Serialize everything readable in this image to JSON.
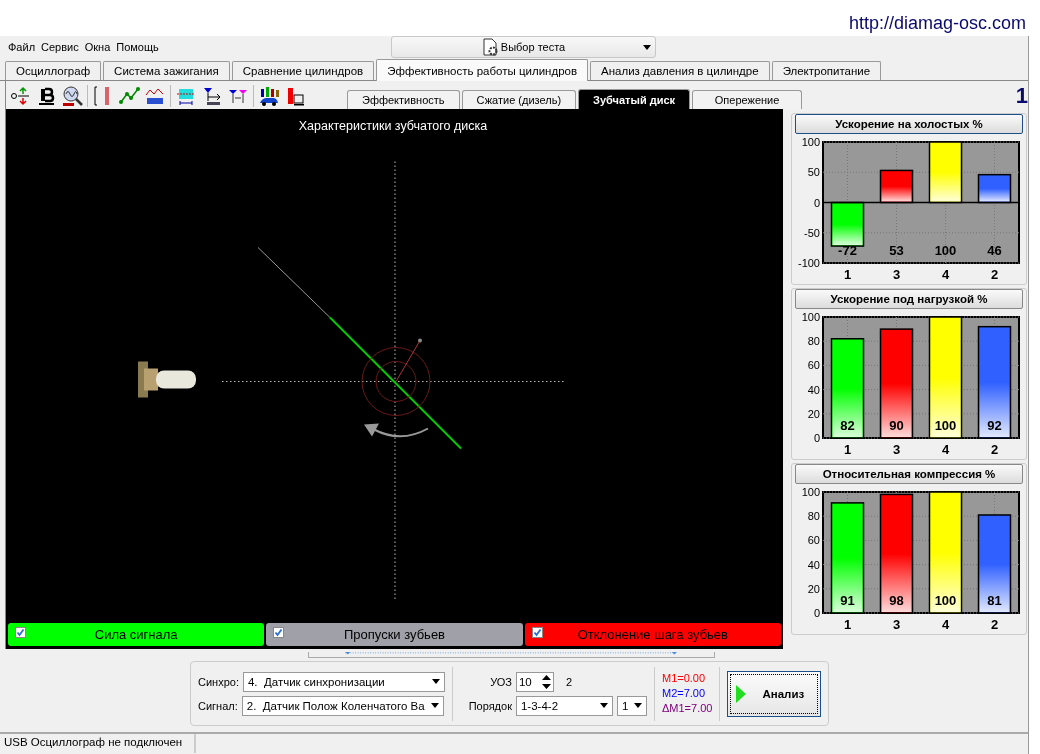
{
  "window": {
    "url": "http://diamag-osc.com"
  },
  "menu": [
    "Файл",
    "Сервис",
    "Окна",
    "Помощь"
  ],
  "test_selector": {
    "value": "Выбор теста"
  },
  "tabs": [
    {
      "label": "Осциллограф",
      "selected": false
    },
    {
      "label": "Система зажигания",
      "selected": false
    },
    {
      "label": "Сравнение цилиндров",
      "selected": false
    },
    {
      "label": "Эффективность работы цилиндров",
      "selected": true
    },
    {
      "label": "Анализ давления в цилиндре",
      "selected": false
    },
    {
      "label": "Электропитание",
      "selected": false
    }
  ],
  "subtabs": [
    {
      "label": "Эффективность",
      "selected": false
    },
    {
      "label": "Сжатие (дизель)",
      "selected": false
    },
    {
      "label": "Зубчатый диск",
      "selected": true
    },
    {
      "label": "Опережение",
      "selected": false
    }
  ],
  "page_number": "1",
  "diagram": {
    "title": "Характеристики зубчатого диска"
  },
  "signal_bars": [
    {
      "label": "Сила сигнала",
      "checked": true,
      "color": "#00ff00"
    },
    {
      "label": "Пропуски зубьев",
      "checked": true,
      "color": "#a0a0a8"
    },
    {
      "label": "Отклонение шага зубьев",
      "checked": true,
      "color": "#ff0000"
    }
  ],
  "charts": [
    {
      "title": "Ускорение на холостых %",
      "bars": [
        {
          "color": "#00ff00"
        },
        {
          "color": "#ff0000"
        },
        {
          "color": "#ffff00"
        },
        {
          "color": "#3060ff"
        }
      ],
      "chart_data": {
        "type": "bar",
        "categories": [
          "1",
          "3",
          "4",
          "2"
        ],
        "values": [
          -72,
          53,
          100,
          46
        ],
        "ylim": [
          -100,
          100
        ],
        "yticks": [
          -100,
          -50,
          0,
          50,
          100
        ],
        "grid": true,
        "data_labels": true
      }
    },
    {
      "title": "Ускорение под нагрузкой %",
      "bars": [
        {
          "color": "#00ff00"
        },
        {
          "color": "#ff0000"
        },
        {
          "color": "#ffff00"
        },
        {
          "color": "#3060ff"
        }
      ],
      "chart_data": {
        "type": "bar",
        "categories": [
          "1",
          "3",
          "4",
          "2"
        ],
        "values": [
          82,
          90,
          100,
          92
        ],
        "ylim": [
          0,
          100
        ],
        "yticks": [
          0,
          20,
          40,
          60,
          80,
          100
        ],
        "grid": true,
        "data_labels": true
      }
    },
    {
      "title": "Относительная компрессия %",
      "bars": [
        {
          "color": "#00ff00"
        },
        {
          "color": "#ff0000"
        },
        {
          "color": "#ffff00"
        },
        {
          "color": "#3060ff"
        }
      ],
      "chart_data": {
        "type": "bar",
        "categories": [
          "1",
          "3",
          "4",
          "2"
        ],
        "values": [
          91,
          98,
          100,
          81
        ],
        "ylim": [
          0,
          100
        ],
        "yticks": [
          0,
          20,
          40,
          60,
          80,
          100
        ],
        "grid": true,
        "data_labels": true
      }
    }
  ],
  "controls": {
    "sync": {
      "label": "Синхро:",
      "value": "4.  Датчик синхронизации"
    },
    "signal": {
      "label": "Сигнал:",
      "value": "2.  Датчик Полож Коленчатого Ва"
    },
    "advance": {
      "label": "УОЗ",
      "value": "10",
      "reading": "2"
    },
    "order": {
      "label": "Порядок",
      "value": "1-3-4-2",
      "cylinder": "1"
    },
    "markers": [
      {
        "text": "M1=0.00",
        "color": "#ff0000"
      },
      {
        "text": "M2=7.00",
        "color": "#0000ff"
      },
      {
        "text": "ΔM1=7.00",
        "color": "#800080"
      }
    ],
    "analyze_button": "Анализ"
  },
  "status_bar": [
    "USB Осциллограф не подключен"
  ]
}
